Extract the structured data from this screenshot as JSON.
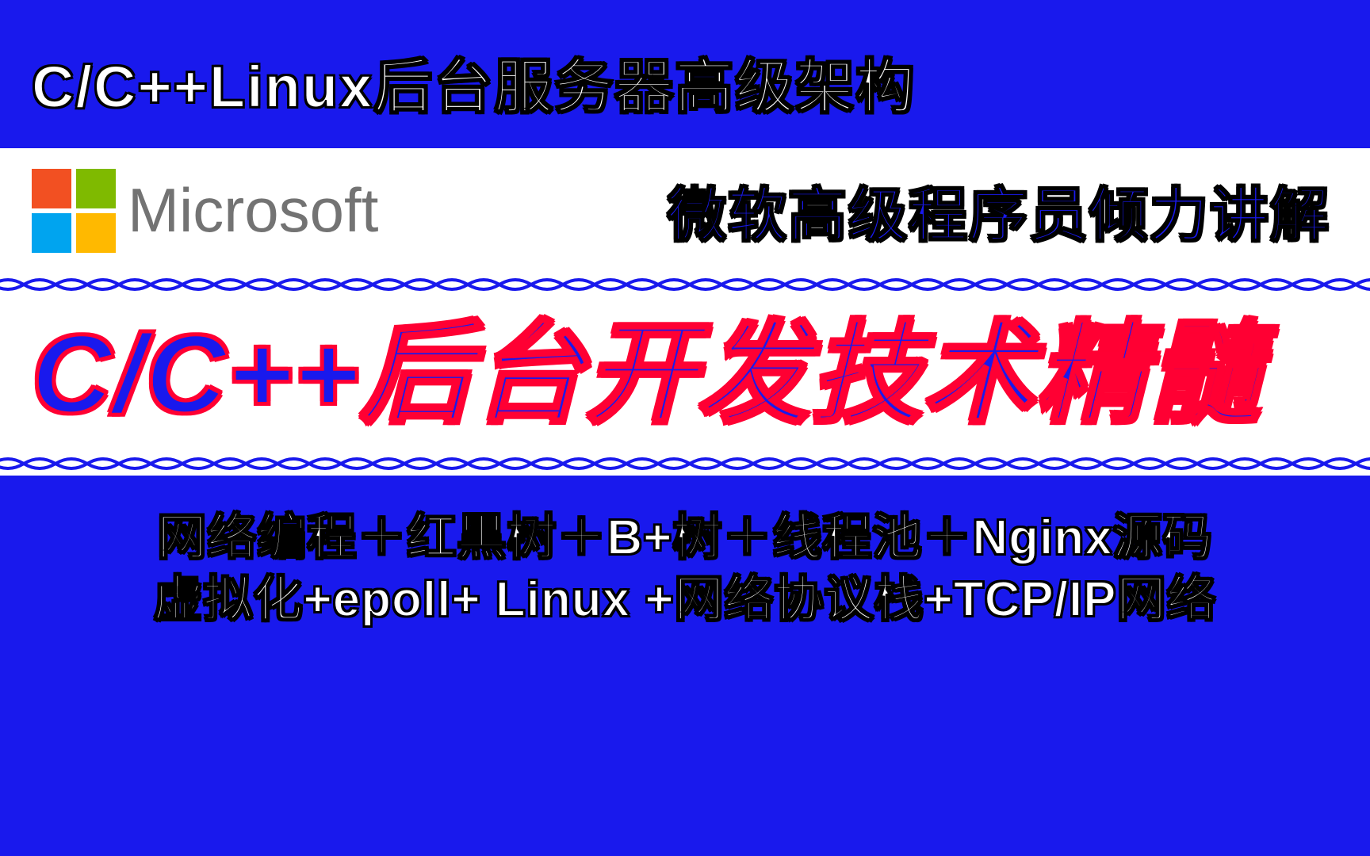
{
  "header": {
    "title": "C/C++Linux后台服务器高级架构"
  },
  "logo": {
    "brand": "Microsoft"
  },
  "presenter": {
    "text": "微软高级程序员倾力讲解"
  },
  "main": {
    "title": "C/C++后台开发技术精髓"
  },
  "footer": {
    "line1": "网络编程＋红黑树＋B+树＋线程池＋Nginx源码",
    "line2": "虚拟化+epoll+ Linux +网络协议栈+TCP/IP网络"
  },
  "colors": {
    "background": "#1919ed",
    "white": "#ffffff",
    "outline_red": "#ff0033",
    "ms_red": "#f25022",
    "ms_green": "#7fba00",
    "ms_blue": "#00a4ef",
    "ms_yellow": "#ffb900"
  }
}
